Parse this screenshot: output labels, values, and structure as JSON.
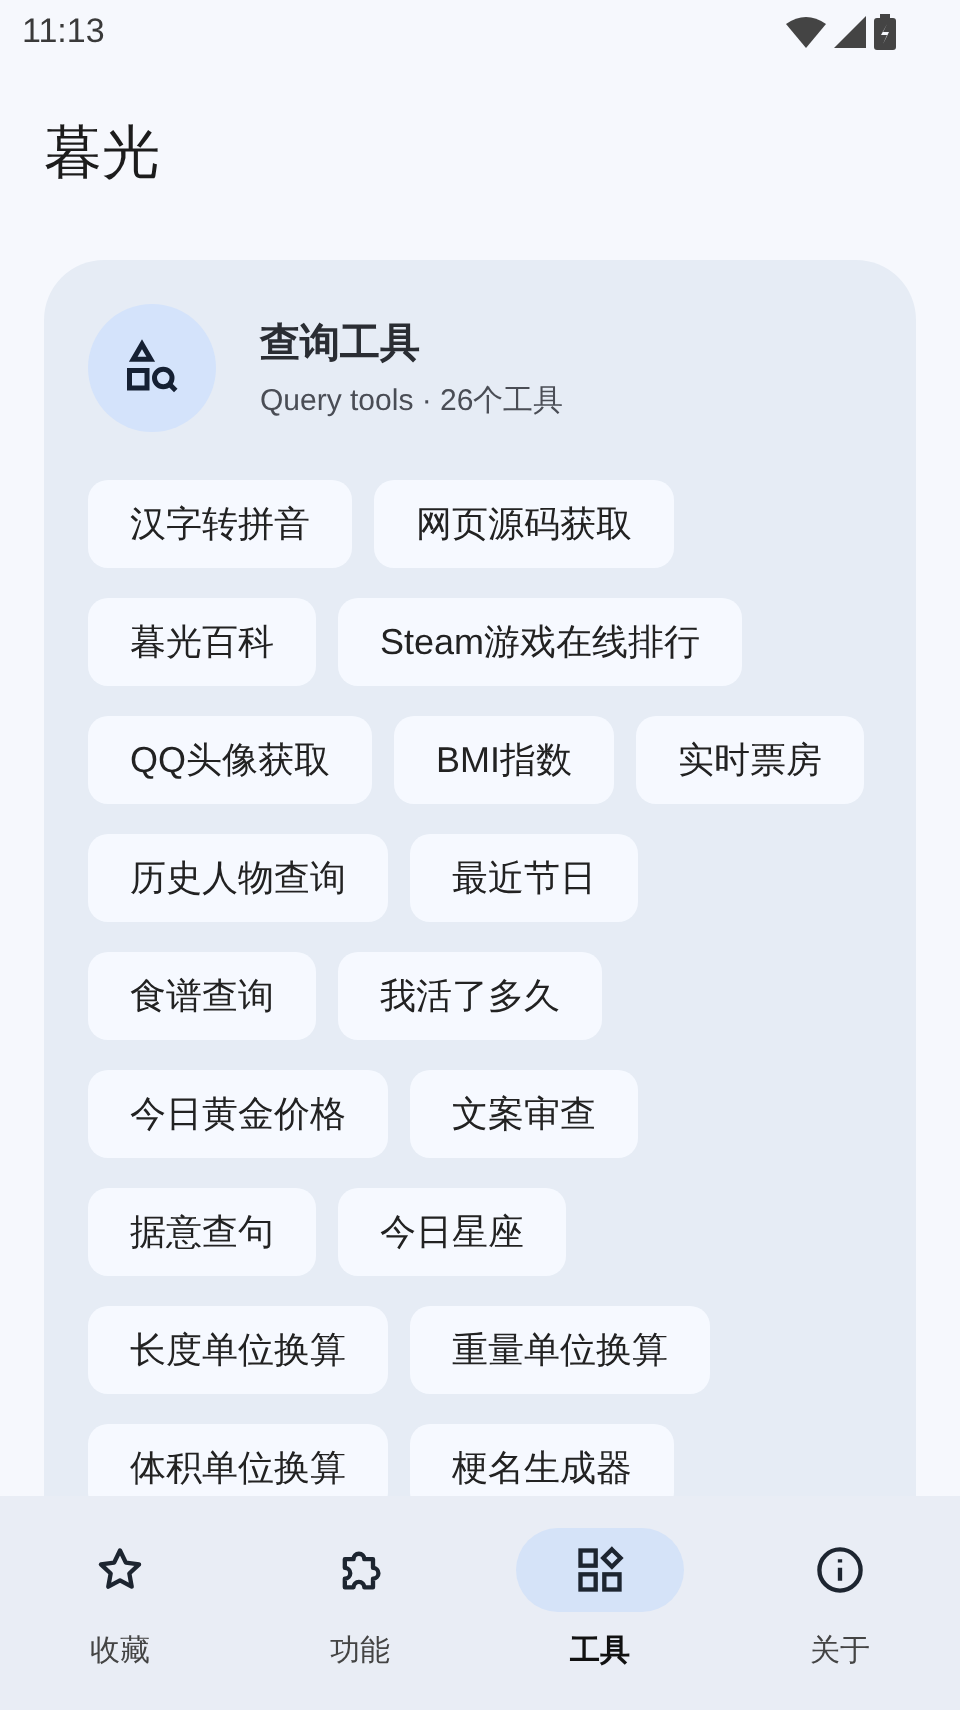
{
  "status_bar": {
    "time": "11:13"
  },
  "app_title": "暮光",
  "card": {
    "title": "查询工具",
    "subtitle": "Query tools · 26个工具",
    "tools": [
      "汉字转拼音",
      "网页源码获取",
      "暮光百科",
      "Steam游戏在线排行",
      "QQ头像获取",
      "BMI指数",
      "实时票房",
      "历史人物查询",
      "最近节日",
      "食谱查询",
      "我活了多久",
      "今日黄金价格",
      "文案审查",
      "据意查句",
      "今日星座",
      "长度单位换算",
      "重量单位换算",
      "体积单位换算",
      "梗名生成器"
    ]
  },
  "nav": [
    {
      "label": "收藏",
      "kind": "star",
      "selected": false
    },
    {
      "label": "功能",
      "kind": "puzzle",
      "selected": false
    },
    {
      "label": "工具",
      "kind": "grid",
      "selected": true
    },
    {
      "label": "关于",
      "kind": "info",
      "selected": false
    }
  ]
}
